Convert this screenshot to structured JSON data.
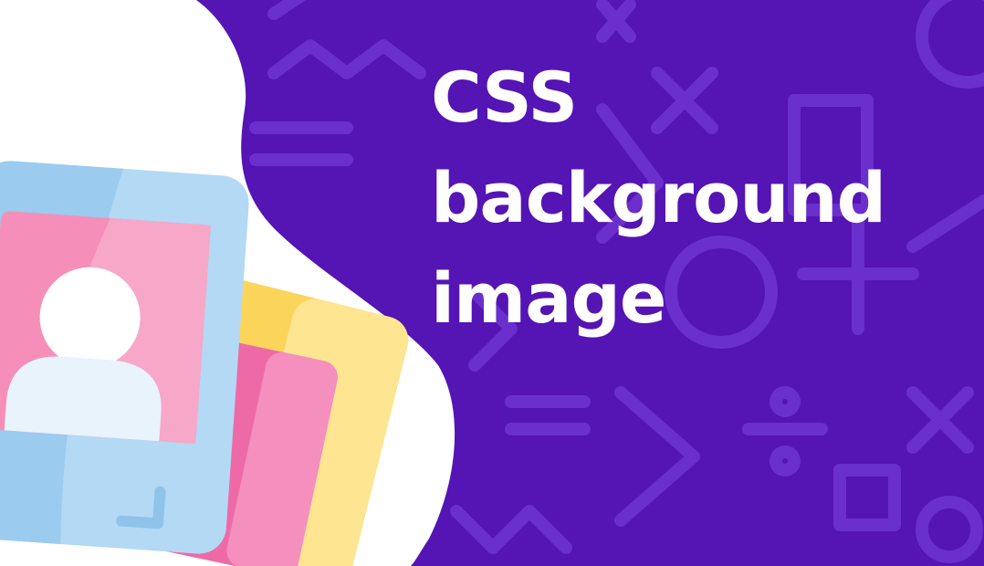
{
  "title_lines": [
    "CSS",
    "background",
    "image"
  ],
  "colors": {
    "background": "#5514b4",
    "pattern_stroke": "#6a2fcc",
    "blob": "#ffffff",
    "card_front": "#b3d9f5",
    "card_front_shade": "#8fc3ea",
    "photo_pink": "#f58fb9",
    "photo_pink_light": "#f7a8c9",
    "avatar": "#ffffff",
    "avatar_body": "#e8f3fc",
    "card_back_yellow": "#fbd55a",
    "card_back_yellow_light": "#fde592",
    "card_middle_pink": "#ee6aa7",
    "card_middle_pink_light": "#f48fbe",
    "title_text": "#ffffff"
  },
  "icons": [
    "geometric-pattern",
    "photo-card-stack-icon",
    "avatar-icon"
  ]
}
